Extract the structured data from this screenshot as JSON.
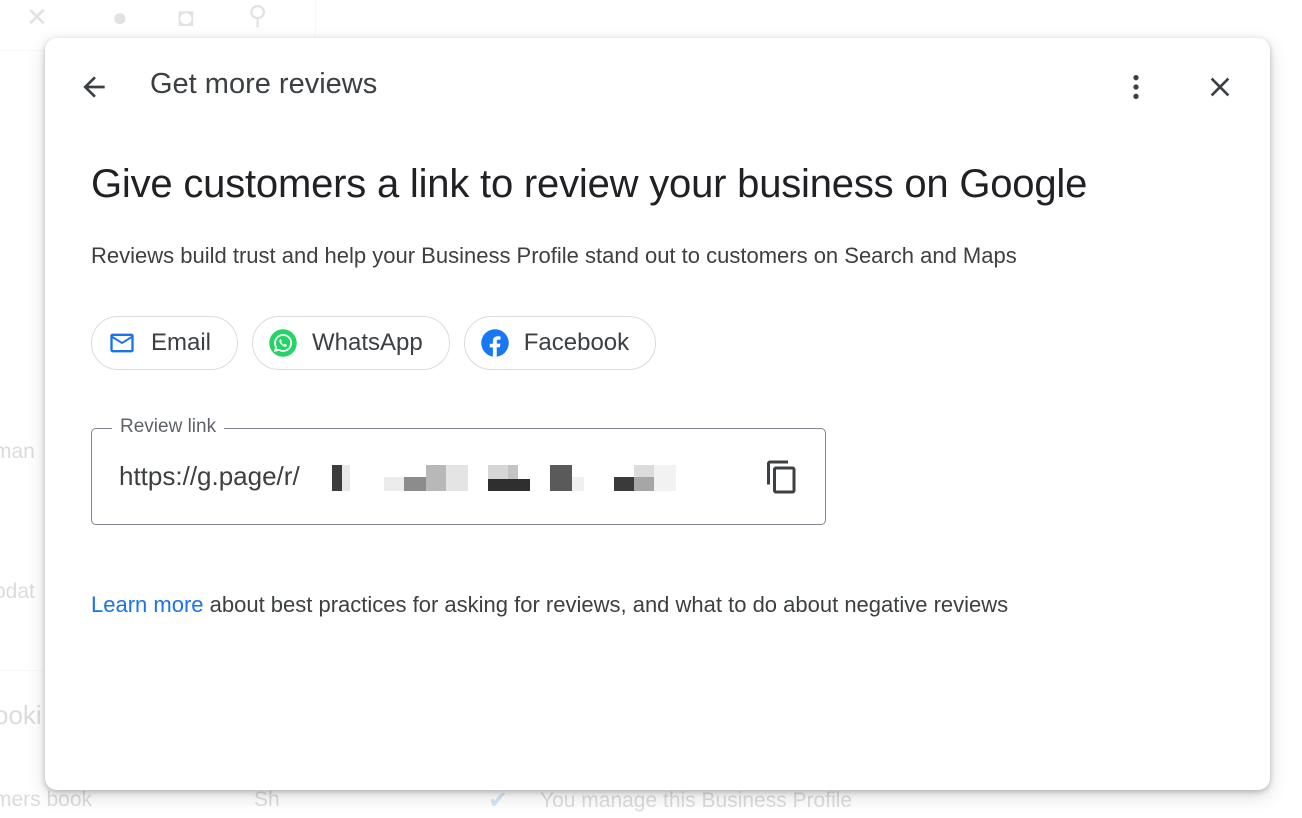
{
  "background": {
    "side_labels": [
      "man",
      "pdat",
      "ooki",
      "mers book",
      "Sh"
    ],
    "verified_text": "You manage this Business Profile"
  },
  "dialog": {
    "title": "Get more reviews",
    "headline": "Give customers a link to review your business on Google",
    "subtext": "Reviews build trust and help your Business Profile stand out to customers on Search and Maps",
    "share_options": [
      {
        "label": "Email",
        "icon": "email-icon"
      },
      {
        "label": "WhatsApp",
        "icon": "whatsapp-icon"
      },
      {
        "label": "Facebook",
        "icon": "facebook-icon"
      }
    ],
    "review_link": {
      "label": "Review link",
      "value": "https://g.page/r/"
    },
    "footer": {
      "link_text": "Learn more",
      "rest_text": " about best practices for asking for reviews, and what to do about negative reviews"
    }
  },
  "colors": {
    "accent": "#1a73e8",
    "whatsapp": "#25d366",
    "facebook": "#1877f2",
    "text_primary": "#202124",
    "text_secondary": "#3c4043"
  }
}
